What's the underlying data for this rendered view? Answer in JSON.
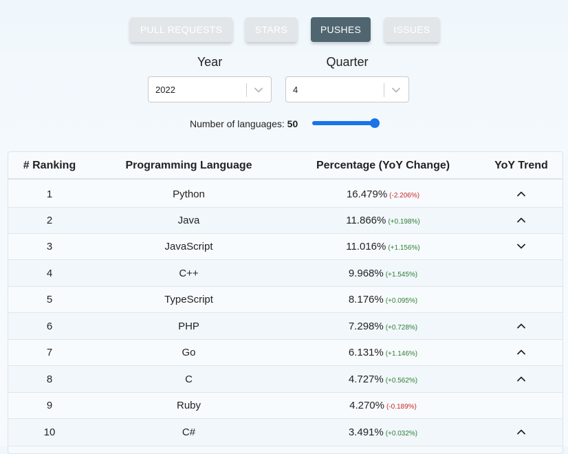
{
  "tabs": [
    {
      "label": "PULL REQUESTS",
      "active": false
    },
    {
      "label": "STARS",
      "active": false
    },
    {
      "label": "PUSHES",
      "active": true
    },
    {
      "label": "ISSUES",
      "active": false
    }
  ],
  "filters": {
    "year_label": "Year",
    "year_value": "2022",
    "quarter_label": "Quarter",
    "quarter_value": "4"
  },
  "slider": {
    "label": "Number of languages:",
    "value": "50",
    "fraction": 1.0
  },
  "table": {
    "headers": [
      "# Ranking",
      "Programming Language",
      "Percentage (YoY Change)",
      "YoY Trend"
    ],
    "rows": [
      {
        "rank": "1",
        "language": "Python",
        "percentage": "16.479%",
        "change": "(-2.206%)",
        "trend": "up"
      },
      {
        "rank": "2",
        "language": "Java",
        "percentage": "11.866%",
        "change": "(+0.198%)",
        "trend": "up"
      },
      {
        "rank": "3",
        "language": "JavaScript",
        "percentage": "11.016%",
        "change": "(+1.156%)",
        "trend": "down"
      },
      {
        "rank": "4",
        "language": "C++",
        "percentage": "9.968%",
        "change": "(+1.545%)",
        "trend": "none"
      },
      {
        "rank": "5",
        "language": "TypeScript",
        "percentage": "8.176%",
        "change": "(+0.095%)",
        "trend": "none"
      },
      {
        "rank": "6",
        "language": "PHP",
        "percentage": "7.298%",
        "change": "(+0.728%)",
        "trend": "up"
      },
      {
        "rank": "7",
        "language": "Go",
        "percentage": "6.131%",
        "change": "(+1.146%)",
        "trend": "up"
      },
      {
        "rank": "8",
        "language": "C",
        "percentage": "4.727%",
        "change": "(+0.562%)",
        "trend": "up"
      },
      {
        "rank": "9",
        "language": "Ruby",
        "percentage": "4.270%",
        "change": "(-0.189%)",
        "trend": "none"
      },
      {
        "rank": "10",
        "language": "C#",
        "percentage": "3.491%",
        "change": "(+0.032%)",
        "trend": "up"
      }
    ]
  },
  "colors": {
    "active_tab": "#4f6670",
    "inactive_tab": "#e2e6e9",
    "slider_accent": "#1a73e8",
    "negative_change": "#c62828",
    "positive_change": "#2e7d32"
  },
  "icons": {
    "select_chevron": "chevron-down-icon",
    "trend_up": "chevron-up-icon",
    "trend_down": "chevron-down-icon"
  }
}
